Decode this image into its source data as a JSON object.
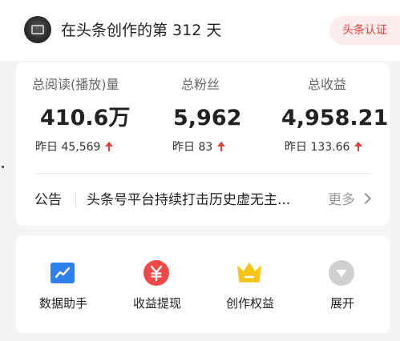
{
  "header": {
    "title": "在头条创作的第 312 天",
    "badge": "头条认证"
  },
  "stats": [
    {
      "label": "总阅读(播放)量",
      "value": "410.6万",
      "yesterday": "昨日 45,569"
    },
    {
      "label": "总粉丝",
      "value": "5,962",
      "yesterday": "昨日 83"
    },
    {
      "label": "总收益",
      "value": "4,958.21",
      "yesterday": "昨日 133.66"
    }
  ],
  "notice": {
    "label": "公告",
    "text": "头条号平台持续打击历史虚无主...",
    "more": "更多"
  },
  "tools": [
    {
      "label": "数据助手",
      "icon": "chart-icon",
      "color": "#2f80ed"
    },
    {
      "label": "收益提现",
      "icon": "yen-icon",
      "color": "#f04848"
    },
    {
      "label": "创作权益",
      "icon": "crown-icon",
      "color": "#f5c518"
    },
    {
      "label": "展开",
      "icon": "expand-icon",
      "color": "#cfcfcf"
    }
  ],
  "colors": {
    "accent_red": "#e8413b",
    "badge_bg": "#fdeceb"
  }
}
